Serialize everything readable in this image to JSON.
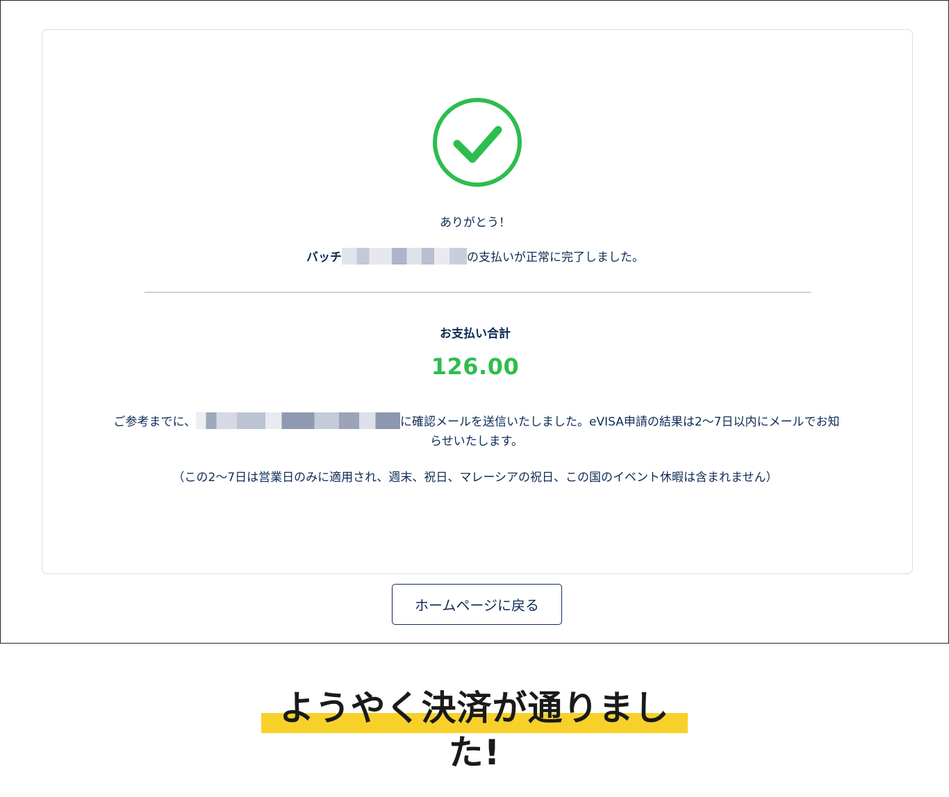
{
  "confirmation": {
    "thanks": "ありがとう！",
    "payment_prefix": "バッチ",
    "payment_suffix": "の支払いが正常に完了しました。",
    "total_label": "お支払い合計",
    "total_amount": "126.00",
    "reference_prefix": "ご参考までに、",
    "reference_suffix": "に確認メールを送信いたしました。eVISA申請の結果は2〜7日以内にメールでお知らせいたします。",
    "note": "（この2〜7日は営業日のみに適用され、週末、祝日、マレーシアの祝日、この国のイベント休暇は含まれません）"
  },
  "actions": {
    "home_button": "ホームページに戻る"
  },
  "caption": {
    "text": "ようやく決済が通りました!"
  },
  "icons": {
    "success": "check-circle-icon"
  },
  "colors": {
    "success": "#2dbd4e",
    "text": "#0d2b55",
    "highlight": "#f7d12a"
  }
}
